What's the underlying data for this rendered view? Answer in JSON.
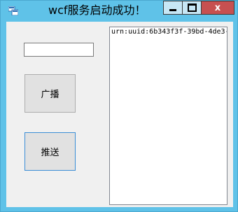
{
  "window": {
    "title": "wcf服务启动成功！",
    "close_glyph": "x"
  },
  "form": {
    "input_value": "",
    "broadcast_label": "广播",
    "push_label": "推送"
  },
  "list": {
    "items": [
      "urn:uuid:6b343f3f-39bd-4de3-"
    ]
  }
}
